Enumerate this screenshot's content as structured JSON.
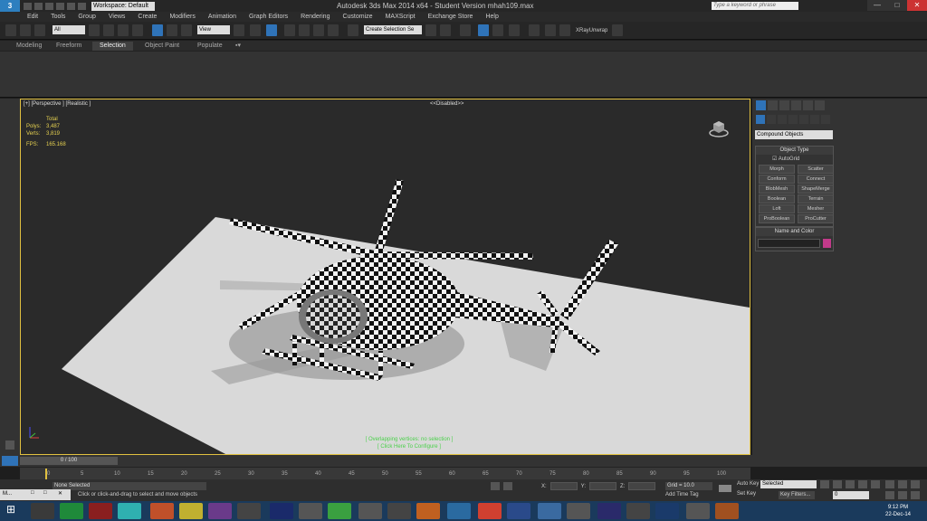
{
  "titlebar": {
    "workspace": "Workspace: Default",
    "title": "Autodesk 3ds Max  2014 x64  - Student Version    mhah109.max",
    "search_placeholder": "Type a keyword or phrase",
    "minimize": "—",
    "maximize": "□",
    "close": "✕"
  },
  "menu": [
    "Edit",
    "Tools",
    "Group",
    "Views",
    "Create",
    "Modifiers",
    "Animation",
    "Graph Editors",
    "Rendering",
    "Customize",
    "MAXScript",
    "Exchange Store",
    "Help"
  ],
  "toolbar": {
    "filter": "All",
    "refcoord": "View",
    "selection_set": "Create Selection Se",
    "xray": "XRayUnwrap"
  },
  "ribbon_tabs": [
    "Modeling",
    "Freeform",
    "Selection",
    "Object Paint",
    "Populate"
  ],
  "ribbon_active": "Selection",
  "viewport": {
    "label": "[+] [Perspective ] [Realistic ]",
    "disabled": "<<Disabled>>",
    "stats_title": "Total",
    "polys_label": "Polys:",
    "polys": "3,487",
    "verts_label": "Verts:",
    "verts": "3,819",
    "fps_label": "FPS:",
    "fps": "165.168",
    "overlap_line1": "[ Overlapping vertices: no selection ]",
    "overlap_line2": "[ Click Here To Configure ]"
  },
  "command_panel": {
    "category": "Compound Objects",
    "object_type_title": "Object Type",
    "autogrid": "AutoGrid",
    "buttons": [
      "Morph",
      "Scatter",
      "Conform",
      "Connect",
      "BlobMesh",
      "ShapeMerge",
      "Boolean",
      "Terrain",
      "Loft",
      "Mesher",
      "ProBoolean",
      "ProCutter"
    ],
    "name_color_title": "Name and Color",
    "swatch_color": "#c23a8a"
  },
  "timeline": {
    "slider": "0 / 100",
    "ticks": [
      "0",
      "5",
      "10",
      "15",
      "20",
      "25",
      "30",
      "35",
      "40",
      "45",
      "50",
      "55",
      "60",
      "65",
      "70",
      "75",
      "80",
      "85",
      "90",
      "95",
      "100"
    ]
  },
  "status": {
    "maxscript": "",
    "selection": "None Selected",
    "hint": "Click or click-and-drag to select and move objects",
    "x_label": "X:",
    "y_label": "Y:",
    "z_label": "Z:",
    "grid": "Grid = 10.0",
    "add_time_tag": "Add Time Tag",
    "auto_key": "Auto Key",
    "set_key": "Set Key",
    "selected": "Selected",
    "key_filters": "Key Filters...",
    "frame": "0"
  },
  "taskbar": {
    "mini_title": "M...",
    "time": "9:12 PM",
    "date": "22-Dec-14"
  }
}
